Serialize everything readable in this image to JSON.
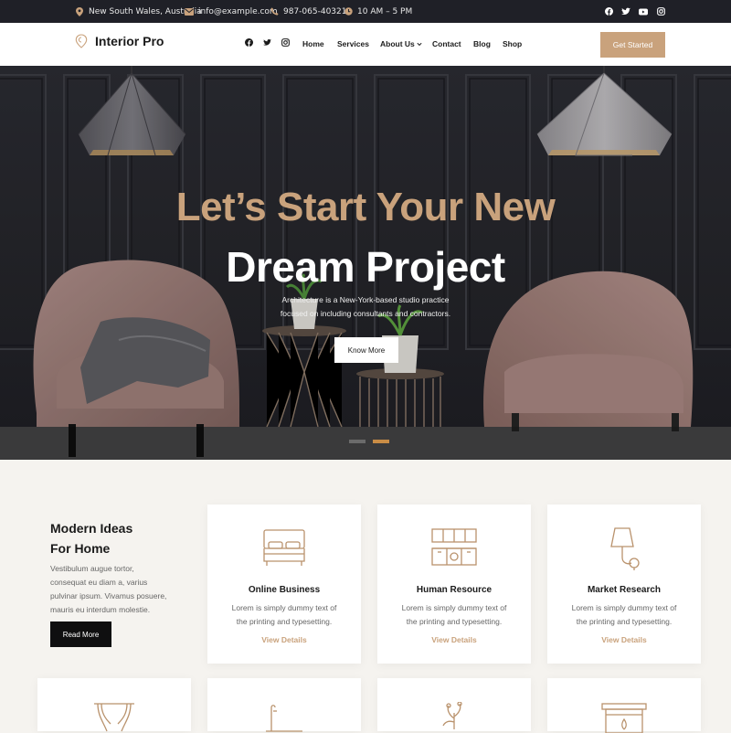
{
  "colors": {
    "accent": "#c9a27c",
    "topbar": "#1f2027",
    "dark_button": "#0f0f10"
  },
  "topbar": {
    "location": "New South Wales, Australia",
    "email": "info@example.com",
    "phone": "987-065-40321",
    "hours": "10 AM – 5 PM",
    "socials": [
      "facebook-icon",
      "twitter-icon",
      "youtube-icon",
      "instagram-icon"
    ]
  },
  "header": {
    "brand": "Interior Pro",
    "socials": [
      "facebook-icon",
      "twitter-icon",
      "instagram-icon"
    ],
    "nav": [
      "Home",
      "Services",
      "About Us",
      "Contact",
      "Blog",
      "Shop"
    ],
    "cta": "Get Started"
  },
  "hero": {
    "title_line1": "Let’s Start Your New",
    "title_line2": "Dream Project",
    "subtitle_line1": "Architecture is a New-York-based studio practice",
    "subtitle_line2": "focused on including consultants and contractors.",
    "button": "Know More",
    "slides": 2,
    "active_slide": 2
  },
  "intro": {
    "title_line1": "Modern Ideas",
    "title_line2": "For Home",
    "text_lines": [
      "Vestibulum augue tortor,",
      "consequat eu diam a, varius",
      "pulvinar ipsum. Vivamus posuere,",
      "mauris eu interdum molestie."
    ],
    "button": "Read More"
  },
  "services": [
    {
      "icon": "bed-icon",
      "title": "Online Business",
      "desc_line1": "Lorem is simply dummy text of",
      "desc_line2": "the printing and typesetting.",
      "link": "View Details"
    },
    {
      "icon": "kitchen-icon",
      "title": "Human Resource",
      "desc_line1": "Lorem is simply dummy text of",
      "desc_line2": "the printing and typesetting.",
      "link": "View Details"
    },
    {
      "icon": "wall-lamp-icon",
      "title": "Market Research",
      "desc_line1": "Lorem is simply dummy text of",
      "desc_line2": "the printing and typesetting.",
      "link": "View Details"
    }
  ],
  "services_row2_icons": [
    "curtains-icon",
    "bathtub-icon",
    "plant-vase-icon",
    "fireplace-icon"
  ]
}
